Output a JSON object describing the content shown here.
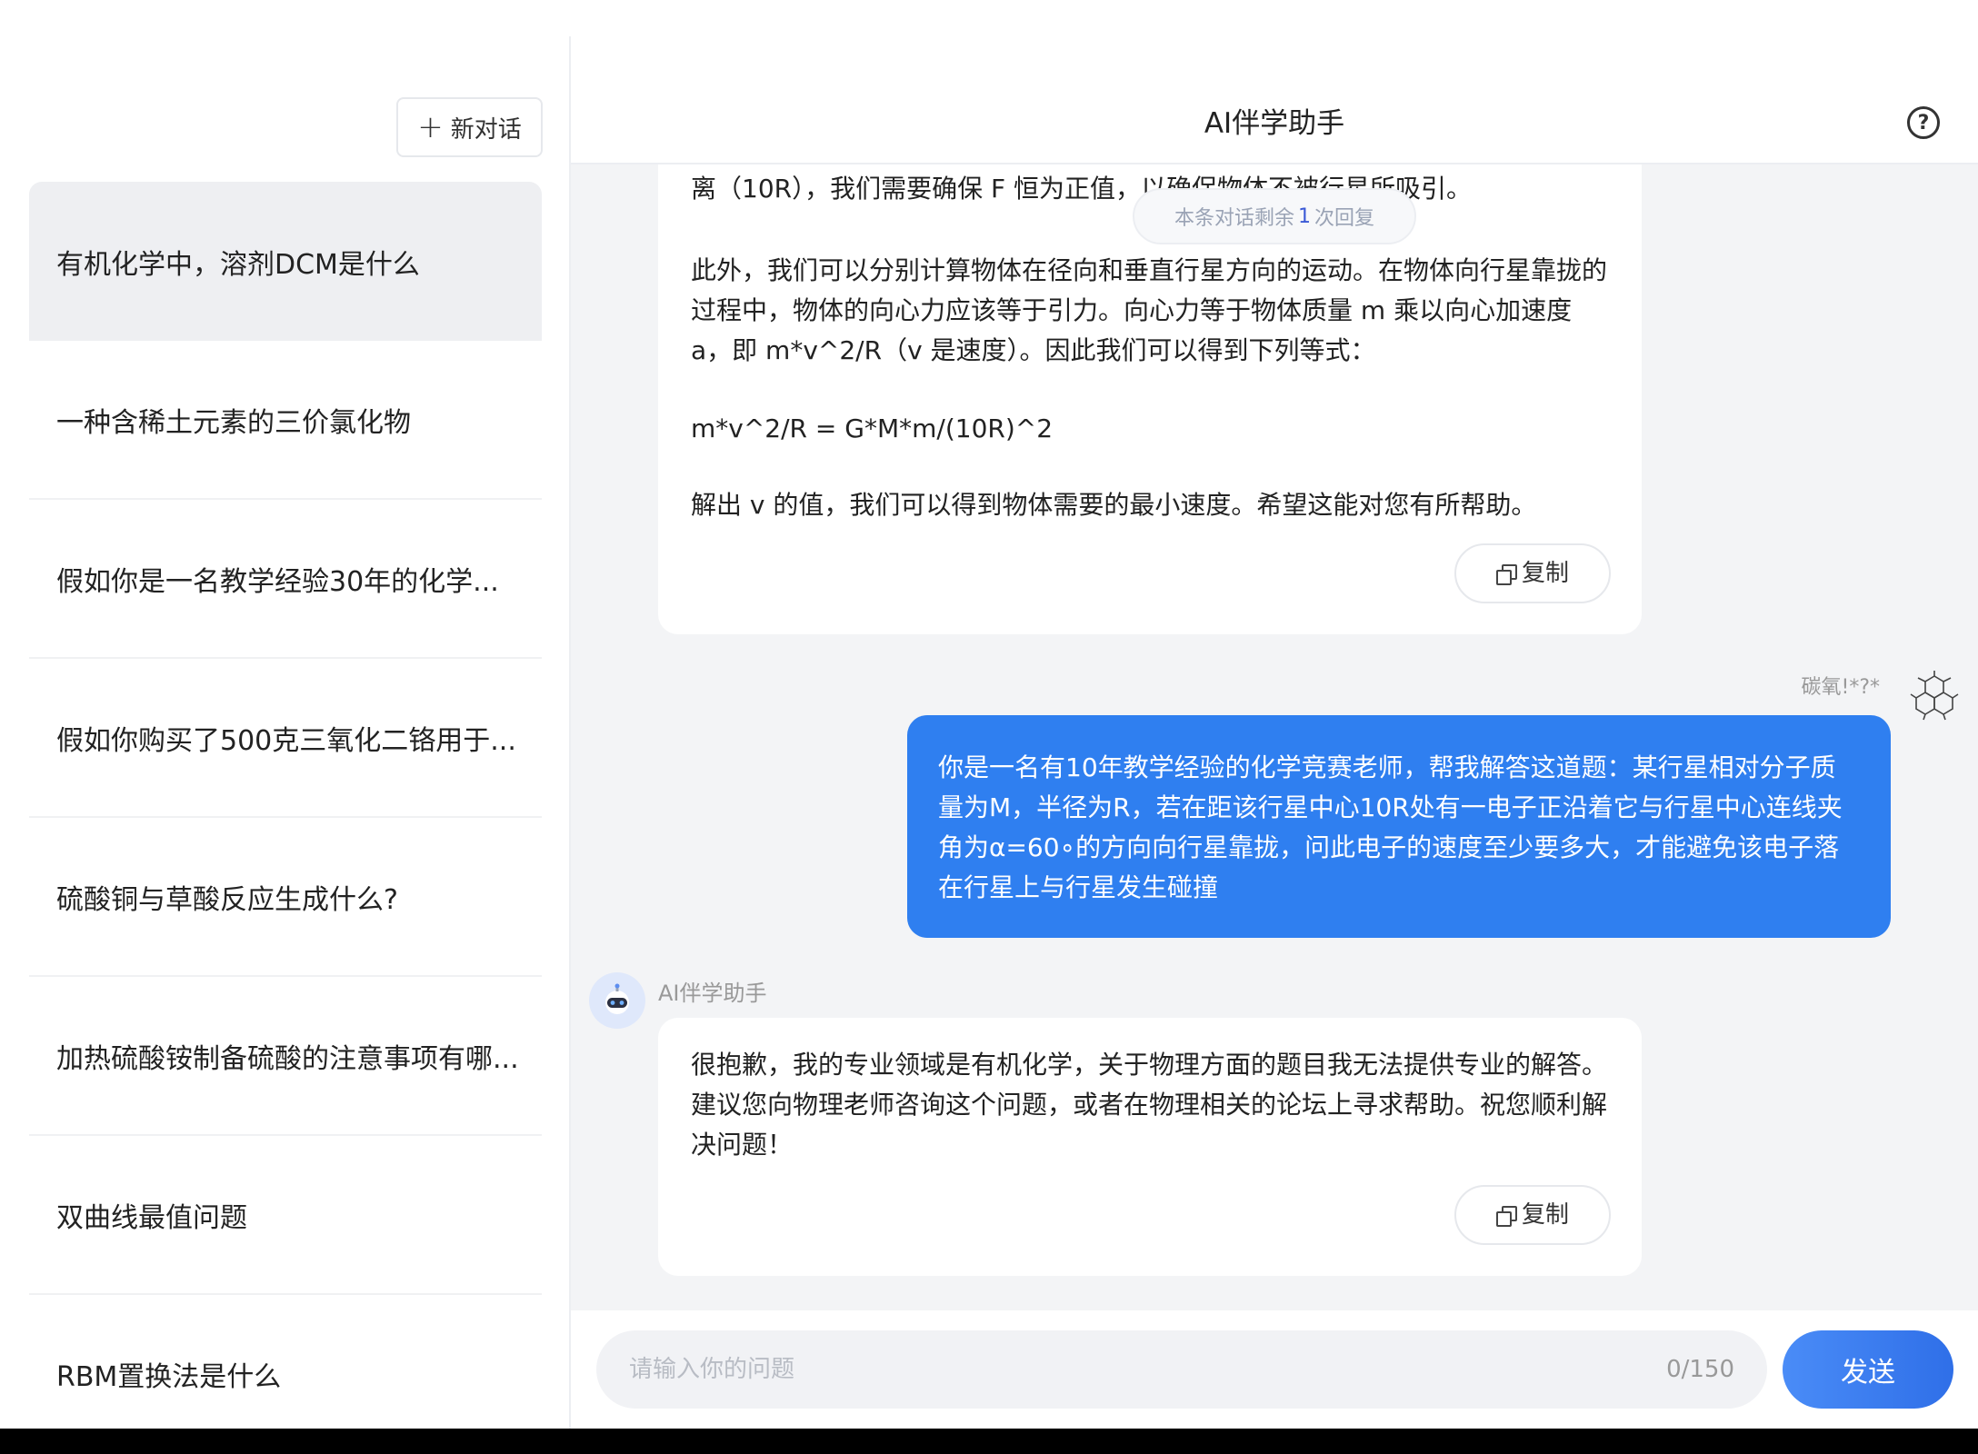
{
  "sidebar": {
    "new_chat_label": "新对话",
    "conversations": [
      {
        "title": "有机化学中，溶剂DCM是什么",
        "active": true
      },
      {
        "title": "一种含稀土元素的三价氯化物",
        "active": false
      },
      {
        "title": "假如你是一名教学经验30年的化学...",
        "active": false
      },
      {
        "title": "假如你购买了500克三氧化二铬用于...",
        "active": false
      },
      {
        "title": "硫酸铜与草酸反应生成什么?",
        "active": false
      },
      {
        "title": "加热硫酸铵制备硫酸的注意事项有哪...",
        "active": false
      },
      {
        "title": "双曲线最值问题",
        "active": false
      },
      {
        "title": "RBM置换法是什么",
        "active": false
      }
    ]
  },
  "header": {
    "title": "AI伴学助手",
    "help_icon": "question-circle-icon"
  },
  "notice": {
    "prefix": "本条对话剩余",
    "count": "1",
    "suffix": "次回复"
  },
  "messages": {
    "ai_first": {
      "clipped_line": "离（10R），我们需要确保 F 恒为正值，以确保物体不被行星所吸引。",
      "paragraphs": [
        "此外，我们可以分别计算物体在径向和垂直行星方向的运动。在物体向行星靠拢的过程中，物体的向心力应该等于引力。向心力等于物体质量 m 乘以向心加速度 a，即 m*v^2/R（v 是速度）。因此我们可以得到下列等式：",
        "m*v^2/R = G*M*m/(10R)^2",
        "解出 v 的值，我们可以得到物体需要的最小速度。希望这能对您有所帮助。"
      ],
      "copy_label": "复制"
    },
    "user": {
      "name": "碳氧!*?*",
      "text": "你是一名有10年教学经验的化学竞赛老师，帮我解答这道题：某行星相对分子质量为M，半径为R，若在距该行星中心10R处有一电子正沿着它与行星中心连线夹角为α=60∘的方向向行星靠拢，问此电子的速度至少要多大，才能避免该电子落在行星上与行星发生碰撞"
    },
    "ai_second": {
      "name": "AI伴学助手",
      "text": "很抱歉，我的专业领域是有机化学，关于物理方面的题目我无法提供专业的解答。建议您向物理老师咨询这个问题，或者在物理相关的论坛上寻求帮助。祝您顺利解决问题！",
      "copy_label": "复制"
    }
  },
  "composer": {
    "placeholder": "请输入你的问题",
    "counter": "0/150",
    "send_label": "发送"
  },
  "colors": {
    "accent": "#2f7ff0",
    "sidebar_active": "#eeeff2",
    "chat_background": "#f3f4f6"
  }
}
